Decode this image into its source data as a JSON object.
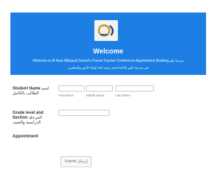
{
  "header": {
    "title": "Welcome",
    "subtitle": "Welcome to Al Noor Bilingual School's Parent Teacher Conference Appointment Booking  مرحبا بكم",
    "subtitle_ar": "في مدرسة النور الثنائية لحجز موعد لقاء أولياء الأمور والمعلمين",
    "accent_color": "#1d7fe4"
  },
  "form": {
    "student_name": {
      "label": "Student Name",
      "label_ar": "اسم الطالب بالكامل",
      "first_label": "First Name",
      "middle_label": "Middle Name",
      "last_label": "Last Name"
    },
    "grade": {
      "label": "Grade level and Section",
      "label_ar": "المرحلة الدراسية والصف"
    },
    "appointment": {
      "label": "Appointment"
    },
    "submit_label": "Submit  إرسال"
  }
}
